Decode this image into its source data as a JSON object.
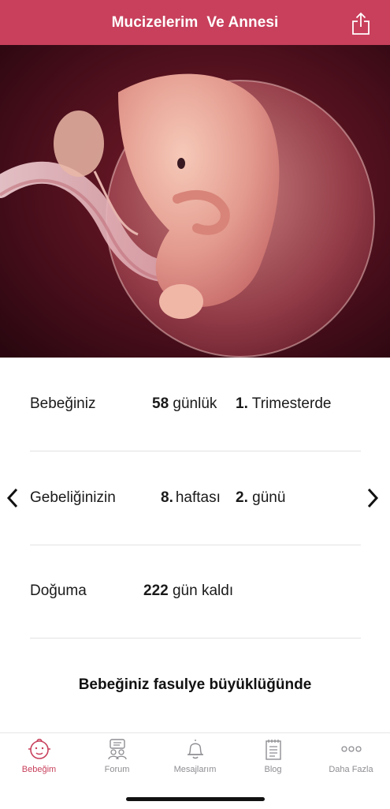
{
  "header": {
    "title_part1": "Mucizelerim",
    "title_part2": "Ve Annesi",
    "share_icon": "share-icon"
  },
  "hero": {
    "image_icon": "fetus-illustration"
  },
  "info": {
    "row1": {
      "label": "Bebeğiniz",
      "days": "58",
      "days_unit": "günlük",
      "trimester": "1.",
      "trimester_text": "Trimesterde"
    },
    "row2": {
      "label": "Gebeliğinizin",
      "week": "8.",
      "week_unit": "haftası",
      "day": "2.",
      "day_unit": "günü"
    },
    "row3": {
      "label": "Doğuma",
      "remaining": "222",
      "remaining_unit": "gün kaldı"
    }
  },
  "banner": {
    "text": "Bebeğiniz fasulye büyüklüğünde"
  },
  "tabbar": {
    "tabs": [
      {
        "label": "Bebeğim",
        "icon": "baby-face-icon"
      },
      {
        "label": "Forum",
        "icon": "forum-icon"
      },
      {
        "label": "Mesajlarım",
        "icon": "bell-icon"
      },
      {
        "label": "Blog",
        "icon": "notepad-icon"
      },
      {
        "label": "Daha Fazla",
        "icon": "more-icon"
      }
    ]
  },
  "colors": {
    "accent": "#c8405c",
    "inactive": "#8e8e93"
  }
}
